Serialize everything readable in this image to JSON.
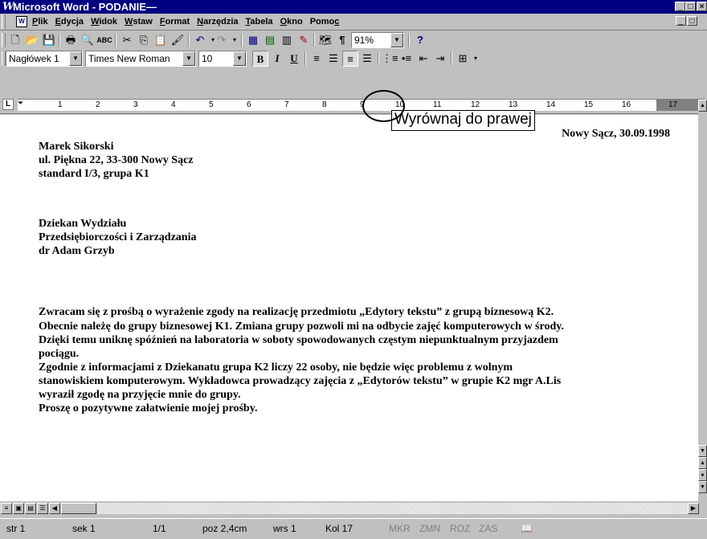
{
  "window": {
    "title": "Microsoft Word - PODANIE—",
    "logo_glyph": "W",
    "controls": [
      "_",
      "□",
      "×"
    ],
    "mdi_controls": [
      "_",
      "□",
      "×"
    ]
  },
  "menu": {
    "items": [
      {
        "label": "Plik",
        "accel": "P",
        "rest": "lik"
      },
      {
        "label": "Edycja",
        "accel": "E",
        "rest": "dycja"
      },
      {
        "label": "Widok",
        "accel": "W",
        "rest": "idok"
      },
      {
        "label": "Wstaw",
        "accel": "W",
        "rest": "staw"
      },
      {
        "label": "Format",
        "accel": "F",
        "rest": "ormat"
      },
      {
        "label": "Narzędzia",
        "accel": "N",
        "rest": "arzędzia"
      },
      {
        "label": "Tabela",
        "accel": "T",
        "rest": "abela"
      },
      {
        "label": "Okno",
        "accel": "O",
        "rest": "kno"
      },
      {
        "label": "Pomoc",
        "accel": "c",
        "prefix": "Pomo"
      }
    ]
  },
  "standard_toolbar": {
    "zoom": "91%",
    "pilcrow": "¶"
  },
  "formatting_toolbar": {
    "style": "Nagłówek 1",
    "font": "Times New Roman",
    "size": "10",
    "bold": "B",
    "italic": "I",
    "underline": "U"
  },
  "ruler": {
    "tab_selector": "L",
    "numbers": [
      "1",
      "2",
      "3",
      "4",
      "5",
      "6",
      "7",
      "8",
      "9",
      "10",
      "11",
      "12",
      "13",
      "14",
      "15",
      "16",
      "17"
    ]
  },
  "tooltip": "Wyrównaj do prawej",
  "document": {
    "date_line": "Nowy Sącz, 30.09.1998",
    "sender": [
      "Marek Sikorski",
      "ul. Piękna 22, 33-300 Nowy Sącz",
      "standard I/3, grupa K1"
    ],
    "recipient": [
      "Dziekan Wydziału",
      "Przedsiębiorczości i Zarządzania",
      "dr Adam Grzyb"
    ],
    "body": [
      "Zwracam się z prośbą o wyrażenie zgody na realizację przedmiotu „Edytory tekstu” z grupą biznesową K2.",
      "Obecnie należę do grupy biznesowej K1. Zmiana grupy pozwoli mi na odbycie zajęć komputerowych w środy.",
      "Dzięki temu uniknę spóźnień na laboratoria w soboty spowodowanych częstym niepunktualnym przyjazdem",
      "pociągu.",
      "Zgodnie z informacjami z Dziekanatu grupa K2 liczy 22 osoby, nie będzie więc problemu z wolnym",
      "stanowiskiem komputerowym. Wykładowca prowadzący zajęcia z „Edytorów tekstu”  w grupie K2 mgr A.Lis",
      "wyraził zgodę na przyjęcie mnie do grupy.",
      "Proszę o pozytywne załatwienie mojej prośby."
    ]
  },
  "status": {
    "page": "str 1",
    "section": "sek 1",
    "pages": "1/1",
    "position": "poz 2,4cm",
    "line": "wrs 1",
    "column": "Kol 17",
    "mkr": "MKR",
    "zmn": "ZMN",
    "roz": "ROZ",
    "zas": "ZAS"
  }
}
